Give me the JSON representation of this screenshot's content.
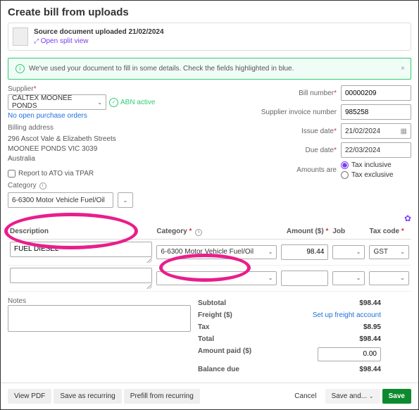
{
  "page_title": "Create bill from uploads",
  "doc": {
    "title": "Source document uploaded 21/02/2024",
    "split": "Open split view"
  },
  "notice": "We've used your document to fill in some details. Check the fields highlighted in blue.",
  "supplier": {
    "label": "Supplier",
    "value": "CALTEX MOONEE PONDS",
    "abn": "ABN active",
    "no_po": "No open purchase orders",
    "billing_addr_label": "Billing address",
    "addr1": "296 Ascot Vale & Elizabeth Streets",
    "addr2": "MOONEE PONDS VIC 3039",
    "addr3": "Australia",
    "tpar": "Report to ATO via TPAR"
  },
  "category": {
    "label": "Category",
    "value": "6-6300  Motor Vehicle Fuel/Oil"
  },
  "right": {
    "bill_no": {
      "label": "Bill number",
      "value": "00000209"
    },
    "sup_inv": {
      "label": "Supplier invoice number",
      "value": "985258"
    },
    "issue": {
      "label": "Issue date",
      "value": "21/02/2024"
    },
    "due": {
      "label": "Due date",
      "value": "22/03/2024"
    },
    "amounts_are": "Amounts are",
    "tax_inc": "Tax inclusive",
    "tax_exc": "Tax exclusive"
  },
  "table": {
    "h": {
      "desc": "Description",
      "cat": "Category",
      "amt": "Amount ($)",
      "job": "Job",
      "tax": "Tax code"
    },
    "rows": [
      {
        "desc": "FUEL DIESEL",
        "cat": "6-6300  Motor Vehicle Fuel/Oil",
        "amt": "98.44",
        "job": "",
        "tax": "GST"
      }
    ]
  },
  "notes_label": "Notes",
  "totals": {
    "subtotal": {
      "l": "Subtotal",
      "v": "$98.44"
    },
    "freight": {
      "l": "Freight ($)",
      "v": "Set up freight account"
    },
    "tax": {
      "l": "Tax",
      "v": "$8.95"
    },
    "total": {
      "l": "Total",
      "v": "$98.44"
    },
    "paid": {
      "l": "Amount paid ($)",
      "v": "0.00"
    },
    "balance": {
      "l": "Balance due",
      "v": "$98.44"
    }
  },
  "footer": {
    "view_pdf": "View PDF",
    "save_recurring": "Save as recurring",
    "prefill": "Prefill from recurring",
    "cancel": "Cancel",
    "save_and": "Save and...",
    "save": "Save"
  }
}
